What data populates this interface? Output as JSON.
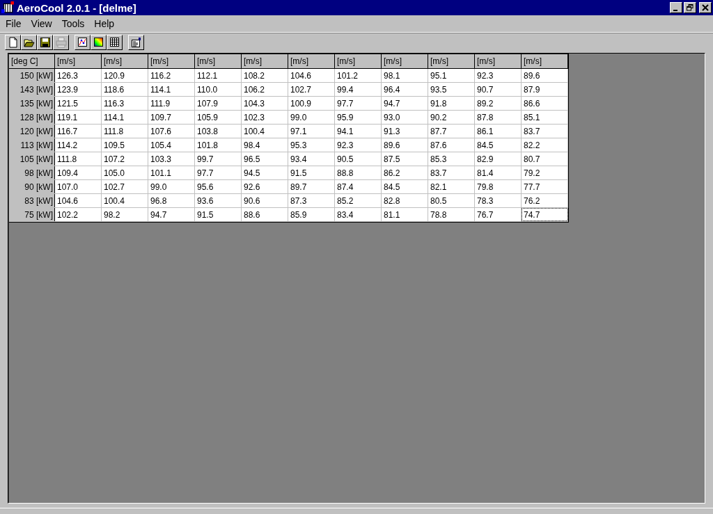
{
  "window": {
    "title": "AeroCool 2.0.1 - [delme]"
  },
  "menu": [
    "File",
    "View",
    "Tools",
    "Help"
  ],
  "toolbar": [
    {
      "kind": "new",
      "disabled": false
    },
    {
      "kind": "open",
      "disabled": false
    },
    {
      "kind": "save",
      "disabled": false
    },
    {
      "kind": "print",
      "disabled": true
    },
    {
      "kind": "chart",
      "disabled": false
    },
    {
      "kind": "gradient",
      "disabled": false
    },
    {
      "kind": "grid",
      "disabled": false
    },
    {
      "kind": "properties",
      "disabled": false
    }
  ],
  "table": {
    "corner": "[deg C]",
    "columns": [
      "[m/s]",
      "[m/s]",
      "[m/s]",
      "[m/s]",
      "[m/s]",
      "[m/s]",
      "[m/s]",
      "[m/s]",
      "[m/s]",
      "[m/s]",
      "[m/s]"
    ],
    "rows": [
      {
        "label": "150  [kW]",
        "cells": [
          {
            "value": "126.3",
            "selected": false
          },
          {
            "value": "120.9",
            "selected": false
          },
          {
            "value": "116.2",
            "selected": false
          },
          {
            "value": "112.1",
            "selected": false
          },
          {
            "value": "108.2",
            "selected": false
          },
          {
            "value": "104.6",
            "selected": false
          },
          {
            "value": "101.2",
            "selected": false
          },
          {
            "value": "98.1",
            "selected": false
          },
          {
            "value": "95.1",
            "selected": false
          },
          {
            "value": "92.3",
            "selected": false
          },
          {
            "value": "89.6",
            "selected": false
          }
        ]
      },
      {
        "label": "143  [kW]",
        "cells": [
          {
            "value": "123.9",
            "selected": false
          },
          {
            "value": "118.6",
            "selected": false
          },
          {
            "value": "114.1",
            "selected": false
          },
          {
            "value": "110.0",
            "selected": false
          },
          {
            "value": "106.2",
            "selected": false
          },
          {
            "value": "102.7",
            "selected": false
          },
          {
            "value": "99.4",
            "selected": false
          },
          {
            "value": "96.4",
            "selected": false
          },
          {
            "value": "93.5",
            "selected": false
          },
          {
            "value": "90.7",
            "selected": false
          },
          {
            "value": "87.9",
            "selected": false
          }
        ]
      },
      {
        "label": "135  [kW]",
        "cells": [
          {
            "value": "121.5",
            "selected": false
          },
          {
            "value": "116.3",
            "selected": false
          },
          {
            "value": "111.9",
            "selected": false
          },
          {
            "value": "107.9",
            "selected": false
          },
          {
            "value": "104.3",
            "selected": false
          },
          {
            "value": "100.9",
            "selected": false
          },
          {
            "value": "97.7",
            "selected": false
          },
          {
            "value": "94.7",
            "selected": false
          },
          {
            "value": "91.8",
            "selected": false
          },
          {
            "value": "89.2",
            "selected": false
          },
          {
            "value": "86.6",
            "selected": false
          }
        ]
      },
      {
        "label": "128  [kW]",
        "cells": [
          {
            "value": "119.1",
            "selected": false
          },
          {
            "value": "114.1",
            "selected": false
          },
          {
            "value": "109.7",
            "selected": false
          },
          {
            "value": "105.9",
            "selected": false
          },
          {
            "value": "102.3",
            "selected": false
          },
          {
            "value": "99.0",
            "selected": false
          },
          {
            "value": "95.9",
            "selected": false
          },
          {
            "value": "93.0",
            "selected": false
          },
          {
            "value": "90.2",
            "selected": false
          },
          {
            "value": "87.8",
            "selected": false
          },
          {
            "value": "85.1",
            "selected": false
          }
        ]
      },
      {
        "label": "120  [kW]",
        "cells": [
          {
            "value": "116.7",
            "selected": false
          },
          {
            "value": "111.8",
            "selected": false
          },
          {
            "value": "107.6",
            "selected": false
          },
          {
            "value": "103.8",
            "selected": false
          },
          {
            "value": "100.4",
            "selected": false
          },
          {
            "value": "97.1",
            "selected": false
          },
          {
            "value": "94.1",
            "selected": false
          },
          {
            "value": "91.3",
            "selected": false
          },
          {
            "value": "87.7",
            "selected": false
          },
          {
            "value": "86.1",
            "selected": false
          },
          {
            "value": "83.7",
            "selected": false
          }
        ]
      },
      {
        "label": "113  [kW]",
        "cells": [
          {
            "value": "114.2",
            "selected": false
          },
          {
            "value": "109.5",
            "selected": false
          },
          {
            "value": "105.4",
            "selected": false
          },
          {
            "value": "101.8",
            "selected": false
          },
          {
            "value": "98.4",
            "selected": false
          },
          {
            "value": "95.3",
            "selected": false
          },
          {
            "value": "92.3",
            "selected": false
          },
          {
            "value": "89.6",
            "selected": false
          },
          {
            "value": "87.6",
            "selected": false
          },
          {
            "value": "84.5",
            "selected": false
          },
          {
            "value": "82.2",
            "selected": false
          }
        ]
      },
      {
        "label": "105  [kW]",
        "cells": [
          {
            "value": "111.8",
            "selected": false
          },
          {
            "value": "107.2",
            "selected": false
          },
          {
            "value": "103.3",
            "selected": false
          },
          {
            "value": "99.7",
            "selected": false
          },
          {
            "value": "96.5",
            "selected": false
          },
          {
            "value": "93.4",
            "selected": false
          },
          {
            "value": "90.5",
            "selected": false
          },
          {
            "value": "87.5",
            "selected": false
          },
          {
            "value": "85.3",
            "selected": false
          },
          {
            "value": "82.9",
            "selected": false
          },
          {
            "value": "80.7",
            "selected": false
          }
        ]
      },
      {
        "label": "98  [kW]",
        "cells": [
          {
            "value": "109.4",
            "selected": false
          },
          {
            "value": "105.0",
            "selected": false
          },
          {
            "value": "101.1",
            "selected": false
          },
          {
            "value": "97.7",
            "selected": false
          },
          {
            "value": "94.5",
            "selected": false
          },
          {
            "value": "91.5",
            "selected": false
          },
          {
            "value": "88.8",
            "selected": false
          },
          {
            "value": "86.2",
            "selected": false
          },
          {
            "value": "83.7",
            "selected": false
          },
          {
            "value": "81.4",
            "selected": false
          },
          {
            "value": "79.2",
            "selected": false
          }
        ]
      },
      {
        "label": "90  [kW]",
        "cells": [
          {
            "value": "107.0",
            "selected": false
          },
          {
            "value": "102.7",
            "selected": false
          },
          {
            "value": "99.0",
            "selected": false
          },
          {
            "value": "95.6",
            "selected": false
          },
          {
            "value": "92.6",
            "selected": false
          },
          {
            "value": "89.7",
            "selected": false
          },
          {
            "value": "87.4",
            "selected": false
          },
          {
            "value": "84.5",
            "selected": false
          },
          {
            "value": "82.1",
            "selected": false
          },
          {
            "value": "79.8",
            "selected": false
          },
          {
            "value": "77.7",
            "selected": false
          }
        ]
      },
      {
        "label": "83  [kW]",
        "cells": [
          {
            "value": "104.6",
            "selected": false
          },
          {
            "value": "100.4",
            "selected": false
          },
          {
            "value": "96.8",
            "selected": false
          },
          {
            "value": "93.6",
            "selected": false
          },
          {
            "value": "90.6",
            "selected": false
          },
          {
            "value": "87.3",
            "selected": false
          },
          {
            "value": "85.2",
            "selected": false
          },
          {
            "value": "82.8",
            "selected": false
          },
          {
            "value": "80.5",
            "selected": false
          },
          {
            "value": "78.3",
            "selected": false
          },
          {
            "value": "76.2",
            "selected": false
          }
        ]
      },
      {
        "label": "75  [kW]",
        "cells": [
          {
            "value": "102.2",
            "selected": false
          },
          {
            "value": "98.2",
            "selected": false
          },
          {
            "value": "94.7",
            "selected": false
          },
          {
            "value": "91.5",
            "selected": false
          },
          {
            "value": "88.6",
            "selected": false
          },
          {
            "value": "85.9",
            "selected": false
          },
          {
            "value": "83.4",
            "selected": false
          },
          {
            "value": "81.1",
            "selected": false
          },
          {
            "value": "78.8",
            "selected": false
          },
          {
            "value": "76.7",
            "selected": false
          },
          {
            "value": "74.7",
            "selected": true
          }
        ]
      }
    ]
  }
}
